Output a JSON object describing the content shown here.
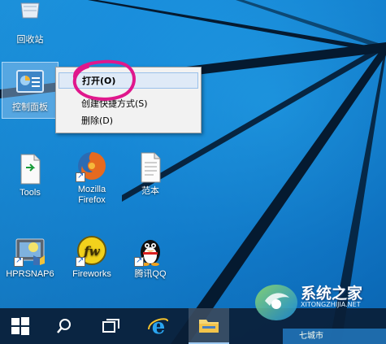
{
  "desktop": {
    "icons": [
      {
        "label": "回收站",
        "icon": "recycle-bin-icon"
      },
      {
        "label": "控制面板",
        "icon": "control-panel-icon"
      },
      {
        "label": "Tools",
        "icon": "text-file-icon"
      },
      {
        "label": "Mozilla Firefox",
        "icon": "firefox-icon"
      },
      {
        "label": "范本",
        "icon": "document-icon"
      },
      {
        "label": "HPRSNAP6",
        "icon": "hprsnap-icon"
      },
      {
        "label": "Fireworks",
        "icon": "fireworks-icon"
      },
      {
        "label": "腾讯QQ",
        "icon": "qq-penguin-icon"
      }
    ]
  },
  "context_menu": {
    "items": [
      {
        "label": "打开(O)",
        "highlighted": true
      },
      {
        "label": "创建快捷方式(S)"
      },
      {
        "label": "删除(D)"
      }
    ]
  },
  "taskbar": {
    "buttons": [
      {
        "icon": "windows-start-icon"
      },
      {
        "icon": "search-icon"
      },
      {
        "icon": "task-view-icon"
      },
      {
        "icon": "internet-explorer-icon"
      },
      {
        "icon": "file-explorer-icon",
        "active": true
      }
    ]
  },
  "watermark": {
    "title": "系统之家",
    "url": "XITONGZHIJIA.NET",
    "bottom": "七城市"
  },
  "colors": {
    "desktop_blue": "#0b78cf",
    "annotation_circle": "#e0178c",
    "menu_highlight": "#dfeaf7"
  }
}
